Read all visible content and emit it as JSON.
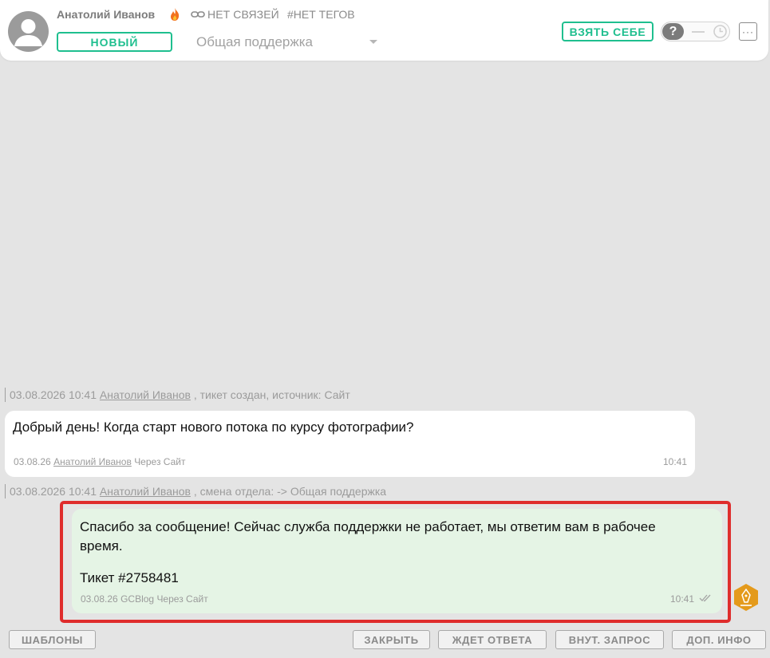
{
  "header": {
    "client_name": "Анатолий Иванов",
    "links": "НЕТ СВЯЗЕЙ",
    "tags": "#НЕТ ТЕГОВ",
    "status": "НОВЫЙ",
    "department": "Общая поддержка",
    "take_button": "ВЗЯТЬ СЕБЕ",
    "toggle_symbol": "?",
    "more_symbol": "···"
  },
  "events": [
    {
      "datetime": "03.08.2026 10:41",
      "author": "Анатолий Иванов",
      "text": ", тикет создан, источник: Сайт"
    },
    {
      "datetime": "03.08.2026 10:41",
      "author": "Анатолий Иванов",
      "text": ", смена отдела: -> Общая поддержка"
    }
  ],
  "messages": {
    "incoming": {
      "text": "Добрый день! Когда старт нового потока по курсу фотографии?",
      "date": "03.08.26",
      "author": "Анатолий Иванов",
      "channel": "Через Сайт",
      "time": "10:41"
    },
    "outgoing": {
      "text": "Спасибо за сообщение! Сейчас служба поддержки не работает, мы ответим вам в рабочее время.",
      "ticket": "Тикет #2758481",
      "date": "03.08.26",
      "author": "GCBlog",
      "channel": "Через Сайт",
      "time": "10:41"
    }
  },
  "footer": {
    "templates": "ШАБЛОНЫ",
    "close": "ЗАКРЫТЬ",
    "awaiting": "ЖДЕТ ОТВЕТА",
    "internal": "ВНУТ. ЗАПРОС",
    "extra_info": "ДОП. ИНФО"
  },
  "colors": {
    "accent": "#1fbf8f",
    "highlight": "#df2c2c",
    "outgoing_bg": "#e5f4e5",
    "signature": "#e49a1b"
  }
}
